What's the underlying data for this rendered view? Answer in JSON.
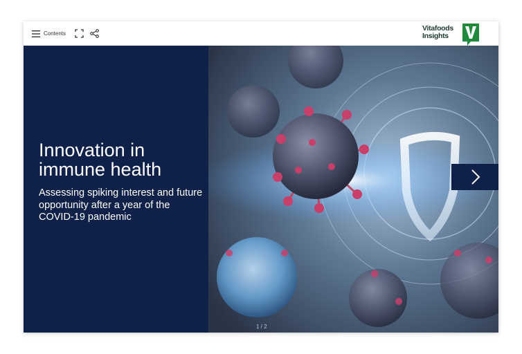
{
  "toolbar": {
    "contents_label": "Contents",
    "icons": [
      "menu-icon",
      "fullscreen-icon",
      "share-icon"
    ]
  },
  "logo": {
    "line1": "Vitafoods",
    "line2": "Insights",
    "mark": "V",
    "color": "#1f8a3c"
  },
  "slide": {
    "title": "Innovation in immune health",
    "subtitle": "Assessing spiking interest and future opportunity after a year of the COVID-19 pandemic",
    "panel_color": "#0f2149",
    "page_indicator": "1 / 2"
  },
  "nav": {
    "next_icon": "chevron-right-icon"
  }
}
